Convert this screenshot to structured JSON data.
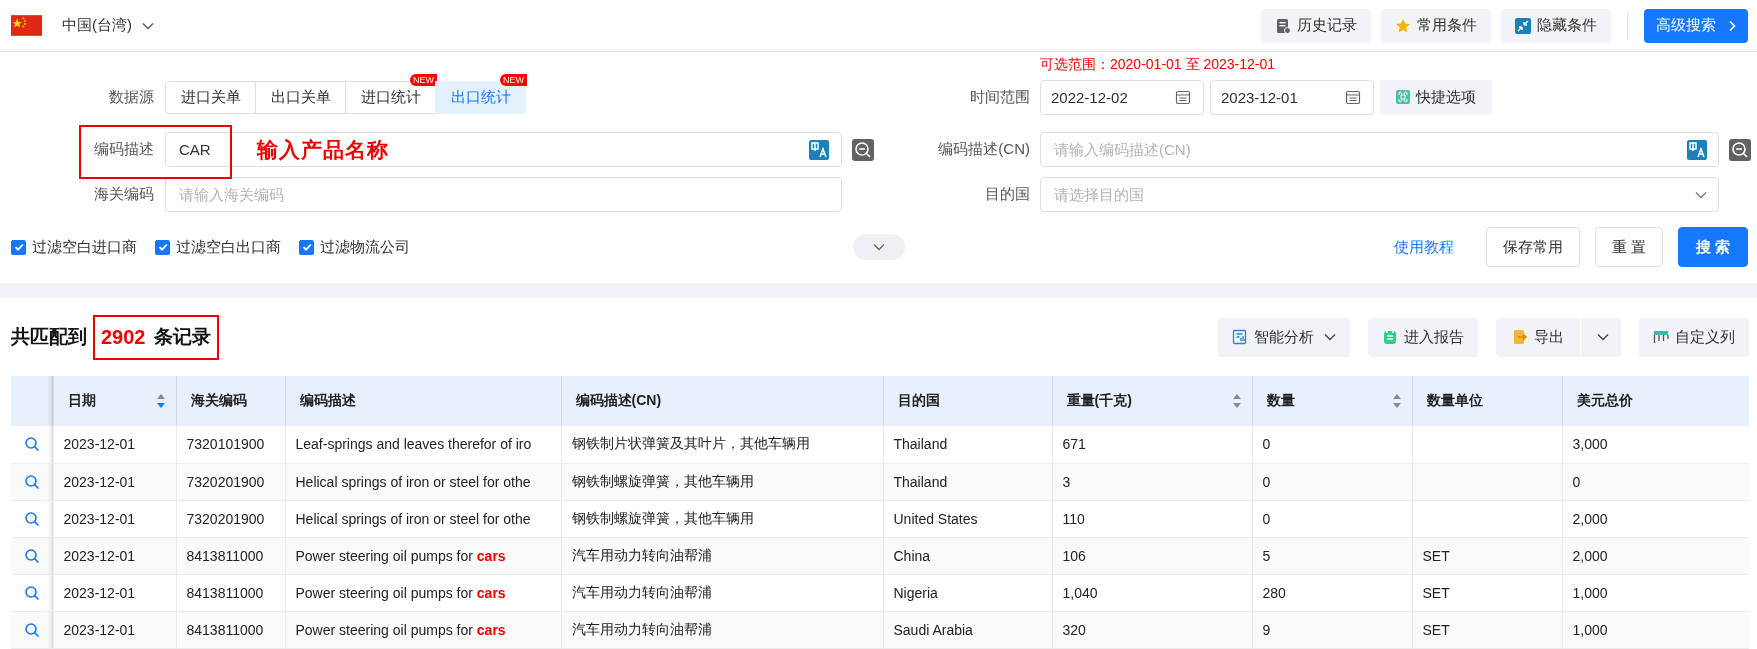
{
  "region": {
    "label": "中国(台湾)"
  },
  "top_buttons": [
    {
      "label": "历史记录",
      "kind": "history"
    },
    {
      "label": "常用条件",
      "kind": "favorite"
    },
    {
      "label": "隐藏条件",
      "kind": "hide"
    },
    {
      "label": "高级搜索",
      "kind": "advanced"
    }
  ],
  "form": {
    "range_note": "可选范围：2020-01-01 至 2023-12-01",
    "data_source": {
      "label": "数据源",
      "tabs": [
        {
          "label": "进口关单",
          "selected": false
        },
        {
          "label": "出口关单",
          "selected": false
        },
        {
          "label": "进口统计",
          "selected": false,
          "badge": "NEW"
        },
        {
          "label": "出口统计",
          "selected": true,
          "badge": "NEW"
        }
      ]
    },
    "time_range": {
      "label": "时间范围",
      "start": "2022-12-02",
      "end": "2023-12-01",
      "quick": "快捷选项"
    },
    "description": {
      "label": "编码描述",
      "value": "CAR",
      "annotation": "输入产品名称",
      "highlighted": true
    },
    "description_cn": {
      "label": "编码描述(CN)",
      "placeholder": "请输入编码描述(CN)"
    },
    "hs_code": {
      "label": "海关编码",
      "placeholder": "请输入海关编码"
    },
    "destination": {
      "label": "目的国",
      "placeholder": "请选择目的国"
    },
    "filters": [
      {
        "label": "过滤空白进口商",
        "checked": true
      },
      {
        "label": "过滤空白出口商",
        "checked": true
      },
      {
        "label": "过滤物流公司",
        "checked": true
      }
    ],
    "expanded": false,
    "tutorial_link": "使用教程",
    "actions": [
      {
        "label": "保存常用",
        "kind": "default"
      },
      {
        "label": "重 置",
        "kind": "default"
      },
      {
        "label": "搜 索",
        "kind": "primary"
      }
    ]
  },
  "results": {
    "prefix": "共匹配到",
    "count": "2902",
    "suffix": "条记录",
    "highlighted": true,
    "tools": [
      {
        "label": "智能分析",
        "kind": "analysis"
      },
      {
        "label": "进入报告",
        "kind": "report"
      },
      {
        "label": "导出",
        "kind": "export"
      },
      {
        "label": "自定义列",
        "kind": "columns"
      }
    ]
  },
  "table": {
    "columns": [
      {
        "label": "日期",
        "kind": "sortable",
        "sorted": true
      },
      {
        "label": "海关编码"
      },
      {
        "label": "编码描述"
      },
      {
        "label": "编码描述(CN)"
      },
      {
        "label": "目的国"
      },
      {
        "label": "重量(千克)",
        "kind": "sortable",
        "sorted": false
      },
      {
        "label": "数量",
        "kind": "sortable",
        "sorted": false
      },
      {
        "label": "数量单位"
      },
      {
        "label": "美元总价"
      }
    ],
    "rows": [
      {
        "date": "2023-12-01",
        "hs_code": "7320101900",
        "description": "Leaf-springs and leaves therefor of iro",
        "description_cn": "钢铁制片状弹簧及其叶片，其他车辆用",
        "destination": "Thailand",
        "weight": "671",
        "quantity": "0",
        "usd_total": "3,000"
      },
      {
        "date": "2023-12-01",
        "hs_code": "7320201900",
        "description": "Helical springs of iron or steel for othe",
        "description_cn": "钢铁制螺旋弹簧，其他车辆用",
        "destination": "Thailand",
        "weight": "3",
        "quantity": "0",
        "usd_total": "0"
      },
      {
        "date": "2023-12-01",
        "hs_code": "7320201900",
        "description": "Helical springs of iron or steel for othe",
        "description_cn": "钢铁制螺旋弹簧，其他车辆用",
        "destination": "United States",
        "weight": "110",
        "quantity": "0",
        "usd_total": "2,000"
      },
      {
        "date": "2023-12-01",
        "hs_code": "8413811000",
        "description": "Power steering oil pumps for **cars**",
        "description_cn": "汽车用动力转向油帮浦",
        "destination": "China",
        "weight": "106",
        "quantity": "5",
        "unit": "SET",
        "usd_total": "2,000"
      },
      {
        "date": "2023-12-01",
        "hs_code": "8413811000",
        "description": "Power steering oil pumps for **cars**",
        "description_cn": "汽车用动力转向油帮浦",
        "destination": "Nigeria",
        "weight": "1,040",
        "quantity": "280",
        "unit": "SET",
        "usd_total": "1,000"
      },
      {
        "date": "2023-12-01",
        "hs_code": "8413811000",
        "description": "Power steering oil pumps for **cars**",
        "description_cn": "汽车用动力转向油帮浦",
        "destination": "Saudi Arabia",
        "weight": "320",
        "quantity": "9",
        "unit": "SET",
        "usd_total": "1,000"
      }
    ]
  }
}
